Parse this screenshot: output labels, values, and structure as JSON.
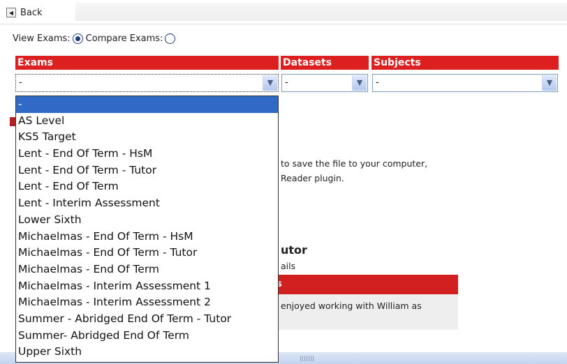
{
  "topbar": {
    "back_label": "Back"
  },
  "modes": {
    "view_label": "View Exams:",
    "compare_label": "Compare Exams:",
    "selected": "view"
  },
  "headers": {
    "exams": "Exams",
    "datasets": "Datasets",
    "subjects": "Subjects"
  },
  "selects": {
    "exams_value": "-",
    "datasets_value": "-",
    "subjects_value": "-"
  },
  "dropdown": {
    "options": [
      "-",
      "AS Level",
      "KS5 Target",
      "Lent - End Of Term - HsM",
      "Lent - End Of Term - Tutor",
      "Lent - End Of Term",
      "Lent - Interim Assessment",
      "Lower Sixth",
      "Michaelmas - End Of Term - HsM",
      "Michaelmas - End Of Term - Tutor",
      "Michaelmas - End Of Term",
      "Michaelmas - Interim Assessment 1",
      "Michaelmas - Interim Assessment 2",
      "Summer - Abridged End Of Term - Tutor",
      "Summer- Abridged End Of Term",
      "Upper Sixth"
    ],
    "selected_index": 0
  },
  "background": {
    "save_text": "to save the file to your computer,",
    "reader_text": "Reader plugin.",
    "tutor_heading": "utor",
    "details_text": "ails",
    "comment_text": "enjoyed working with William as",
    "bar_fragment": "s"
  }
}
